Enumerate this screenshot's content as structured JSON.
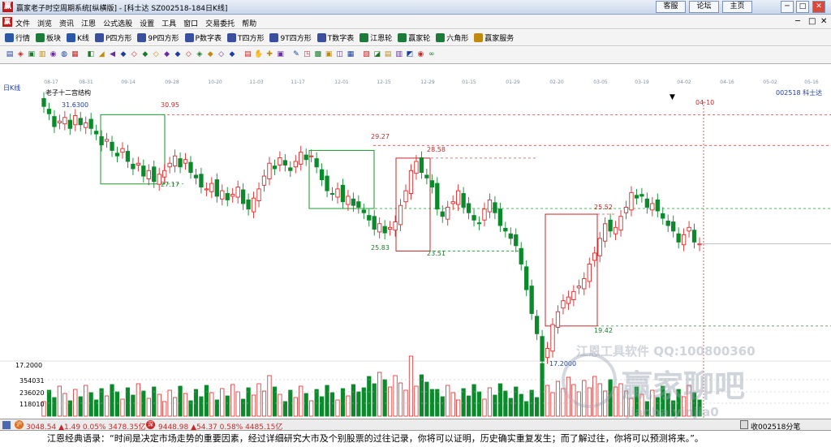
{
  "window": {
    "title": "赢家老子时空周期系统[纵横版] - [科士达  SZ002518-184日K线]",
    "links": [
      "客服",
      "论坛",
      "主页"
    ],
    "controls": [
      "─",
      "□",
      "✕"
    ],
    "logo": "赢"
  },
  "menu": {
    "items": [
      "文件",
      "浏览",
      "资讯",
      "江恩",
      "公式选股",
      "设置",
      "工具",
      "窗口",
      "交易委托",
      "帮助"
    ],
    "window_controls": [
      "─",
      "□",
      "✕"
    ]
  },
  "toolbar1": [
    {
      "label": "行情",
      "icon": "market-icon",
      "color": "#2a58a6"
    },
    {
      "label": "板块",
      "icon": "sector-icon",
      "color": "#1c7a3a"
    },
    {
      "label": "K线",
      "icon": "kline-icon",
      "color": "#2a58a6"
    },
    {
      "label": "P四方形",
      "icon": "p-square-icon",
      "color": "#3a4fa0"
    },
    {
      "label": "9P四方形",
      "icon": "9p-square-icon",
      "color": "#3a4fa0"
    },
    {
      "label": "P数字表",
      "icon": "p-table-icon",
      "color": "#3a4fa0"
    },
    {
      "label": "T四方形",
      "icon": "t-square-icon",
      "color": "#3a4fa0"
    },
    {
      "label": "9T四方形",
      "icon": "9t-square-icon",
      "color": "#3a4fa0"
    },
    {
      "label": "T数字表",
      "icon": "t-table-icon",
      "color": "#3a4fa0"
    },
    {
      "label": "江恩轮",
      "icon": "gann-wheel-icon",
      "color": "#1c7a3a"
    },
    {
      "label": "赢家轮",
      "icon": "winner-wheel-icon",
      "color": "#1c7a3a"
    },
    {
      "label": "六角形",
      "icon": "hexagon-icon",
      "color": "#1c7a3a"
    },
    {
      "label": "赢家服务",
      "icon": "service-icon",
      "color": "#c08a10"
    }
  ],
  "chart": {
    "period_label": "日K线",
    "structure_label": "老子十二宫结构",
    "stock_label": "002518  科士达",
    "date_marker": "04-10",
    "date_axis": [
      "08-17",
      "08-31",
      "09-14",
      "09-28",
      "10-20",
      "11-03",
      "11-17",
      "12-01",
      "12-15",
      "12-29",
      "01-15",
      "01-29",
      "02-20",
      "03-05",
      "03-19",
      "04-02",
      "04-16",
      "05-02",
      "05-16"
    ],
    "start_price": "31.6300",
    "low_price": "17.2000",
    "axis_low": "17.2000",
    "price_levels": [
      "30.95",
      "27.17",
      "29.27",
      "25.83",
      "28.58",
      "23.51",
      "25.52",
      "19.42"
    ],
    "volume_ticks": [
      "354031",
      "236020",
      "118010"
    ],
    "watermark_brand": "江恩工具软件  QQ:100800360",
    "watermark_big": "赢家聊吧",
    "watermark_url": "jiaoba.yinjia0"
  },
  "status": {
    "sh": "3048.54 ▲1.49 0.05% 3478.35亿",
    "sz": "9448.98 ▲54.37 0.58% 4485.15亿",
    "right": "收002518分笔"
  },
  "quote": "江恩经典语录：“时间是决定市场走势的重要因素，经过详细研究大市及个别股票的过往记录，你将可以证明，历史确实重复发生；而了解过往，你将可以预测将来。”。",
  "colors": {
    "up": "#e02828",
    "down": "#0a8a2a",
    "box_green": "#1a9a2a",
    "box_red": "#c82828"
  }
}
